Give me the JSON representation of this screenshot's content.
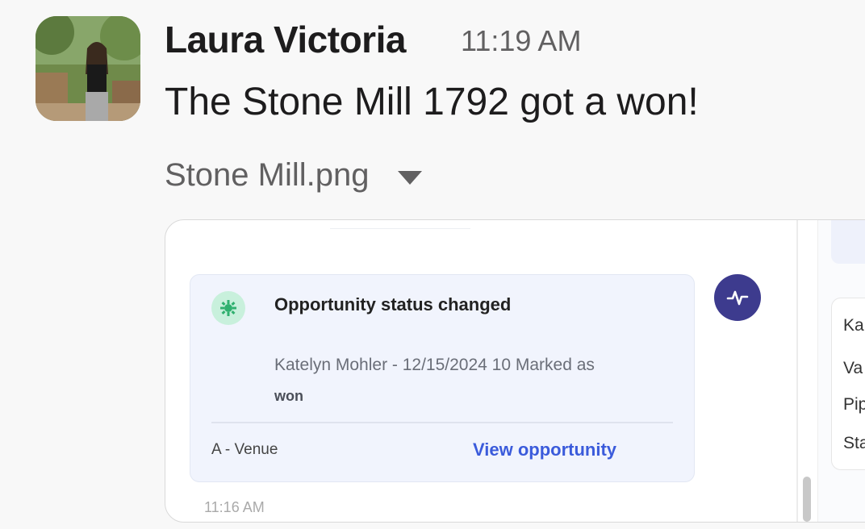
{
  "message": {
    "author": "Laura Victoria",
    "timestamp": "11:19 AM",
    "text": "The Stone Mill 1792 got a won!",
    "file": {
      "name": "Stone Mill.png",
      "toggle_icon": "caret-down-icon"
    }
  },
  "attachment": {
    "activity": {
      "icon": "gear-icon",
      "title": "Opportunity status changed",
      "description": "Katelyn Mohler - 12/15/2024 10 Marked as",
      "status": "won",
      "type": "A - Venue",
      "link_label": "View opportunity"
    },
    "activity_button_icon": "activity-pulse-icon",
    "time": "11:16 AM",
    "right_panel_lines": [
      "Ka",
      "Va",
      "Pip",
      "Sta"
    ]
  },
  "colors": {
    "link": "#3b5bdb",
    "activity_button": "#3d3b8e",
    "icon_bg": "#c8f0dc"
  }
}
